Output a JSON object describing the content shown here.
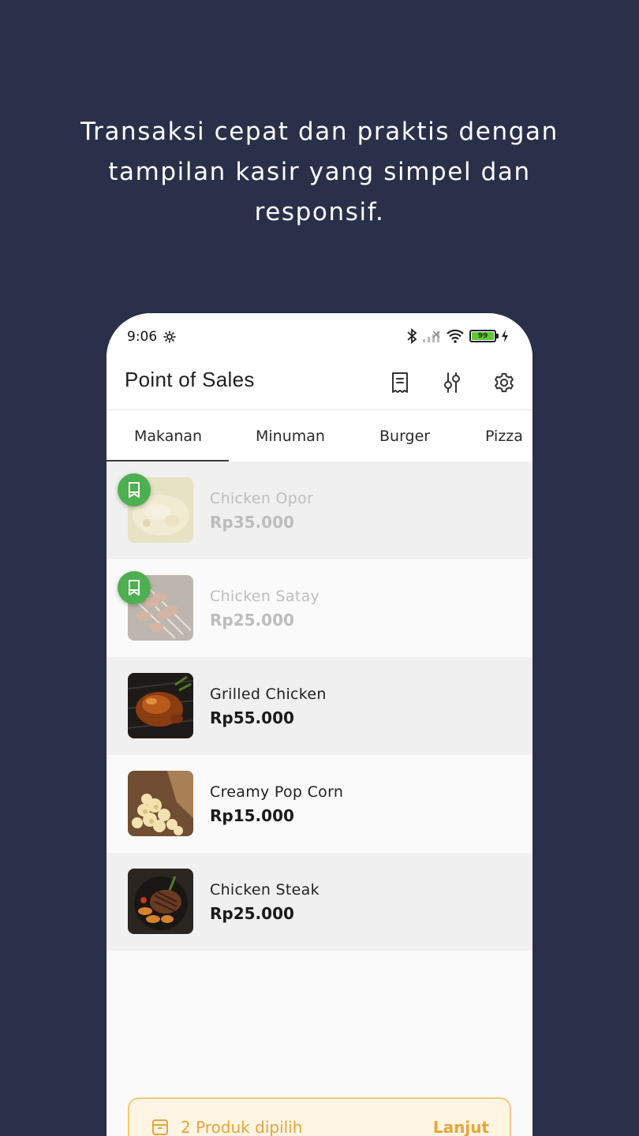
{
  "headline": {
    "line1": "Transaksi cepat dan praktis dengan",
    "line2": "tampilan kasir yang simpel dan",
    "line3": "responsif."
  },
  "status_bar": {
    "time": "9:06",
    "battery": "99"
  },
  "app_bar": {
    "title": "Point of Sales",
    "actions": [
      "receipt-icon",
      "filter-sliders-icon",
      "settings-gear-icon"
    ]
  },
  "tabs": [
    {
      "label": "Makanan",
      "active": true
    },
    {
      "label": "Minuman",
      "active": false
    },
    {
      "label": "Burger",
      "active": false
    },
    {
      "label": "Pizza",
      "active": false
    }
  ],
  "products": [
    {
      "name": "Chicken Opor",
      "price": "Rp35.000",
      "selected": true
    },
    {
      "name": "Chicken Satay",
      "price": "Rp25.000",
      "selected": true
    },
    {
      "name": "Grilled Chicken",
      "price": "Rp55.000",
      "selected": false
    },
    {
      "name": "Creamy Pop Corn",
      "price": "Rp15.000",
      "selected": false
    },
    {
      "name": "Chicken Steak",
      "price": "Rp25.000",
      "selected": false
    }
  ],
  "cart_bar": {
    "text": "2 Produk dipilih",
    "action": "Lanjut"
  },
  "colors": {
    "background": "#2a3049",
    "selected_badge": "#4caf50",
    "cart_accent": "#e8a43a"
  }
}
